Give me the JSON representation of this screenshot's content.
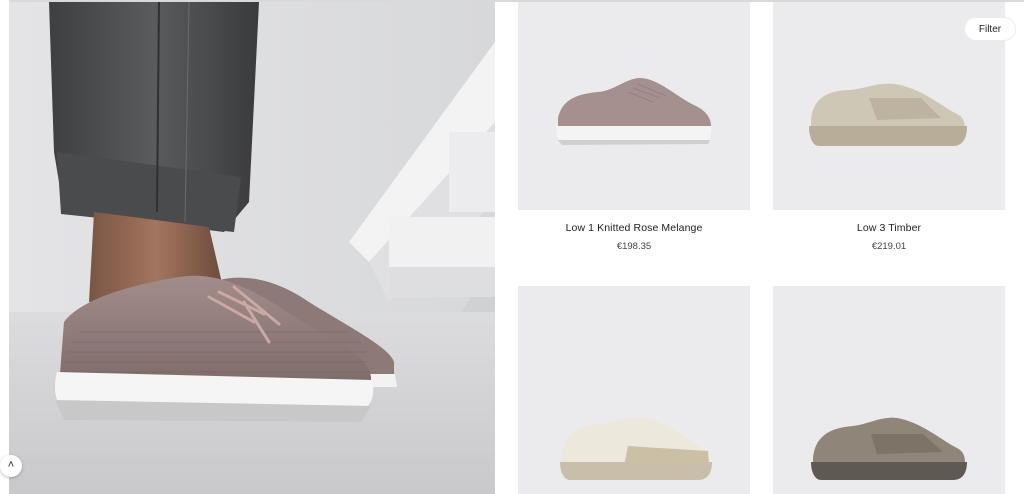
{
  "filter": {
    "label": "Filter"
  },
  "scroll_top": {
    "glyph": "˄",
    "icon": "chevron-up-icon"
  },
  "products": [
    {
      "name": "Low 1 Knitted Rose Melange",
      "price": "€198.35",
      "color": "#a3908f"
    },
    {
      "name": "Low 3 Timber",
      "price": "€219.01",
      "color": "#cfc7b6"
    },
    {
      "name": "",
      "price": "",
      "color": "#ece8dc"
    },
    {
      "name": "",
      "price": "",
      "color": "#8f8679"
    }
  ]
}
